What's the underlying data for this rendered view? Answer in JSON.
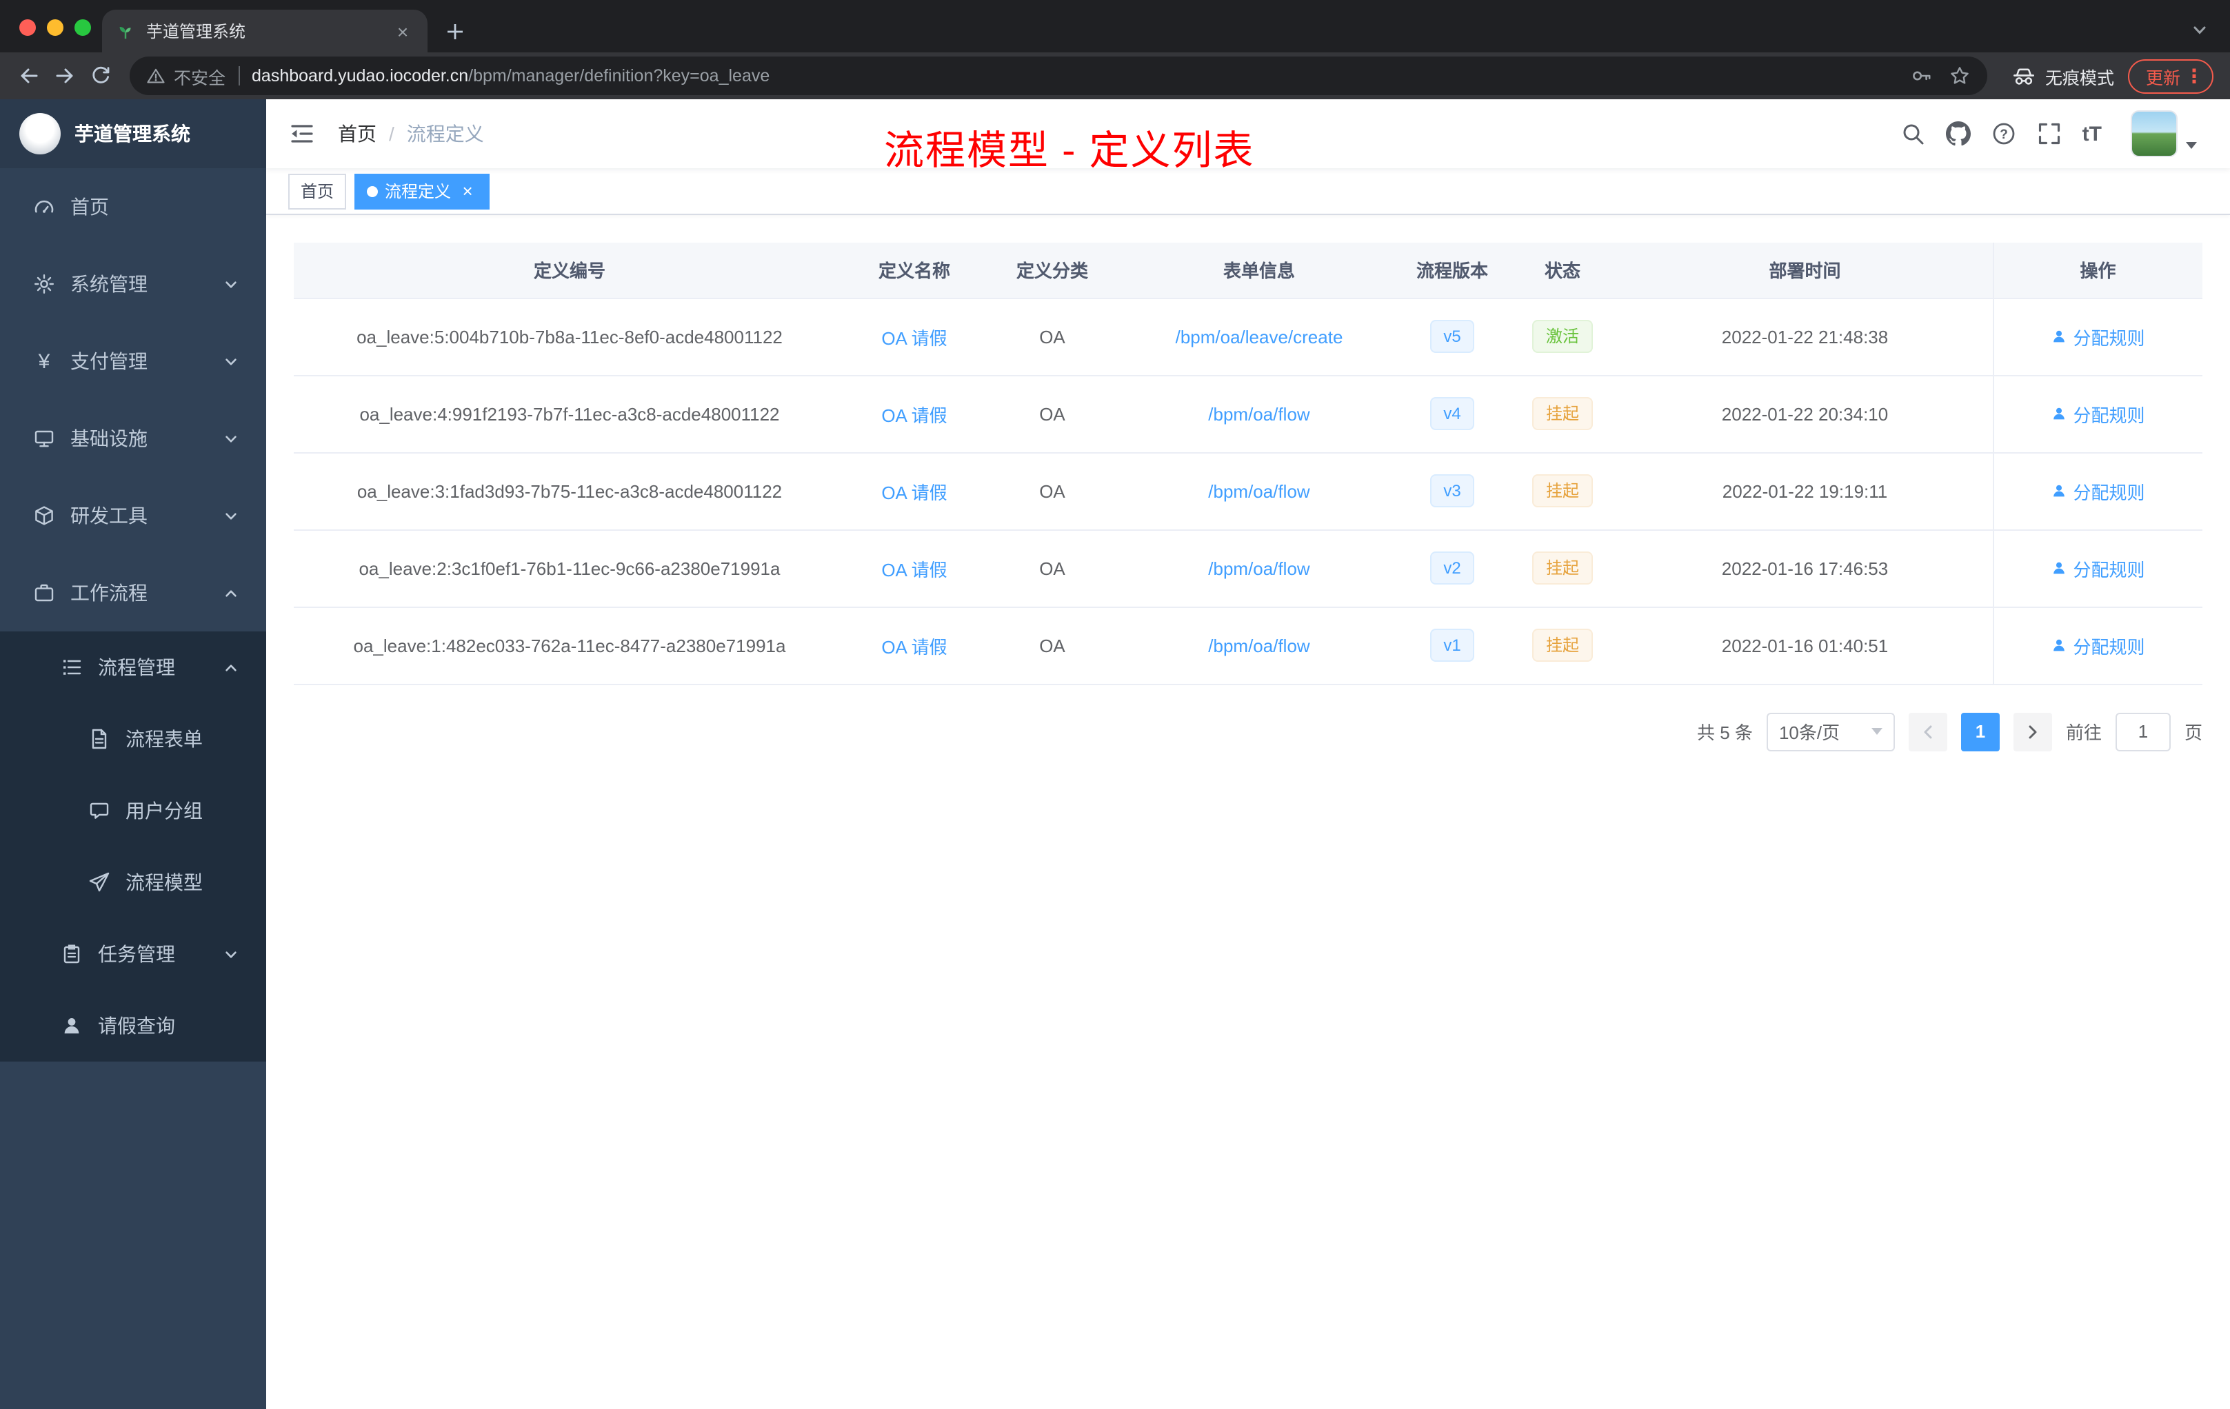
{
  "browser": {
    "tab_title": "芋道管理系统",
    "security_label": "不安全",
    "url_host": "dashboard.yudao.iocoder.cn",
    "url_path": "/bpm/manager/definition?key=oa_leave",
    "incognito_label": "无痕模式",
    "update_label": "更新"
  },
  "sidebar": {
    "logo_title": "芋道管理系统",
    "items": [
      {
        "label": "首页"
      },
      {
        "label": "系统管理"
      },
      {
        "label": "支付管理"
      },
      {
        "label": "基础设施"
      },
      {
        "label": "研发工具"
      },
      {
        "label": "工作流程"
      },
      {
        "label": "流程管理"
      },
      {
        "label": "流程表单"
      },
      {
        "label": "用户分组"
      },
      {
        "label": "流程模型"
      },
      {
        "label": "任务管理"
      },
      {
        "label": "请假查询"
      }
    ]
  },
  "navbar": {
    "breadcrumb_home": "首页",
    "breadcrumb_sep": "/",
    "breadcrumb_current": "流程定义",
    "font_size_icon_label": "tT",
    "annotation": "流程模型 - 定义列表"
  },
  "tags": {
    "home": "首页",
    "active": "流程定义",
    "close": "×"
  },
  "table": {
    "headers": [
      "定义编号",
      "定义名称",
      "定义分类",
      "表单信息",
      "流程版本",
      "状态",
      "部署时间",
      "操作"
    ],
    "rows": [
      {
        "id": "oa_leave:5:004b710b-7b8a-11ec-8ef0-acde48001122",
        "name": "OA 请假",
        "category": "OA",
        "form": "/bpm/oa/leave/create",
        "version": "v5",
        "status": "激活",
        "time": "2022-01-22 21:48:38",
        "action": "分配规则"
      },
      {
        "id": "oa_leave:4:991f2193-7b7f-11ec-a3c8-acde48001122",
        "name": "OA 请假",
        "category": "OA",
        "form": "/bpm/oa/flow",
        "version": "v4",
        "status": "挂起",
        "time": "2022-01-22 20:34:10",
        "action": "分配规则"
      },
      {
        "id": "oa_leave:3:1fad3d93-7b75-11ec-a3c8-acde48001122",
        "name": "OA 请假",
        "category": "OA",
        "form": "/bpm/oa/flow",
        "version": "v3",
        "status": "挂起",
        "time": "2022-01-22 19:19:11",
        "action": "分配规则"
      },
      {
        "id": "oa_leave:2:3c1f0ef1-76b1-11ec-9c66-a2380e71991a",
        "name": "OA 请假",
        "category": "OA",
        "form": "/bpm/oa/flow",
        "version": "v2",
        "status": "挂起",
        "time": "2022-01-16 17:46:53",
        "action": "分配规则"
      },
      {
        "id": "oa_leave:1:482ec033-762a-11ec-8477-a2380e71991a",
        "name": "OA 请假",
        "category": "OA",
        "form": "/bpm/oa/flow",
        "version": "v1",
        "status": "挂起",
        "time": "2022-01-16 01:40:51",
        "action": "分配规则"
      }
    ]
  },
  "pagination": {
    "total": "共 5 条",
    "page_size": "10条/页",
    "page": "1",
    "goto": "前往",
    "goto_value": "1",
    "unit": "页"
  },
  "colors": {
    "accent": "#409eff",
    "success": "#67c23a",
    "warning": "#e6a23c",
    "annotation_red": "#fe0000"
  }
}
